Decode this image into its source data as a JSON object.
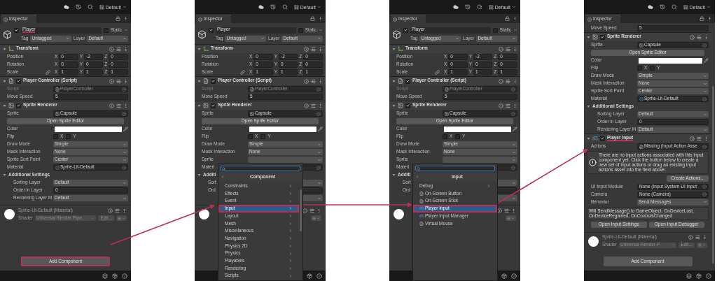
{
  "panels": [
    {
      "layout": "Default",
      "tab": "Inspector",
      "scrollable": false,
      "rows": [
        {
          "kind": "object",
          "name": "Player",
          "active": true,
          "underlined": true,
          "static_label": "Static",
          "static": false,
          "tag_label": "Tag",
          "tag": "Untagged",
          "layer_label": "Layer",
          "layer": "Default"
        },
        {
          "kind": "transform",
          "title": "Transform",
          "underlined": false
        },
        {
          "kind": "vector",
          "label": "Position",
          "linked": false,
          "fields": [
            {
              "axis": "X",
              "value": "0"
            },
            {
              "axis": "Y",
              "value": "-2"
            },
            {
              "axis": "Z",
              "value": "0"
            }
          ]
        },
        {
          "kind": "vector",
          "label": "Rotation",
          "linked": false,
          "fields": [
            {
              "axis": "X",
              "value": "0"
            },
            {
              "axis": "Y",
              "value": "0"
            },
            {
              "axis": "Z",
              "value": "0"
            }
          ]
        },
        {
          "kind": "vector",
          "label": "Scale",
          "linked": true,
          "fields": [
            {
              "axis": "X",
              "value": "1"
            },
            {
              "axis": "Y",
              "value": "1"
            },
            {
              "axis": "Z",
              "value": "1"
            }
          ]
        },
        {
          "kind": "script_component",
          "enabled": true,
          "underlined": false,
          "title": "Player Controller (Script)"
        },
        {
          "kind": "script_field",
          "label": "Script",
          "value": "PlayerController",
          "disabled": true
        },
        {
          "kind": "text_field",
          "label": "Move Speed",
          "value": "5",
          "disabled": false
        },
        {
          "kind": "sprite_component",
          "enabled": true,
          "underlined": false,
          "title": "Sprite Renderer"
        },
        {
          "kind": "sprite_field",
          "label": "Sprite",
          "value": "Capsule",
          "disabled": false
        },
        {
          "kind": "button",
          "label": "Open Sprite Editor"
        },
        {
          "kind": "color",
          "label": "Color",
          "color": "#ffffff"
        },
        {
          "kind": "flip",
          "label": "Flip",
          "options": [
            {
              "label": "X",
              "checked": false
            },
            {
              "label": "Y",
              "checked": false
            }
          ]
        },
        {
          "kind": "dropdown_field",
          "label": "Draw Mode",
          "value": "Simple",
          "disabled": false
        },
        {
          "kind": "dropdown_field",
          "label": "Mask Interaction",
          "value": "None",
          "disabled": false
        },
        {
          "kind": "dropdown_field",
          "label": "Sprite Sort Point",
          "value": "Center",
          "disabled": false
        },
        {
          "kind": "material_field",
          "label": "Material",
          "value": "Sprite-Lit-Default",
          "disabled": false
        },
        {
          "kind": "foldout",
          "label": "Additional Settings",
          "expanded": true,
          "children": [
            {
              "kind": "dropdown_field",
              "label": "Sorting Layer",
              "value": "Default",
              "disabled": false
            },
            {
              "kind": "text_field",
              "label": "Order in Layer",
              "value": "0",
              "disabled": false
            },
            {
              "kind": "dropdown_field",
              "label": "Rendering Layer M",
              "value": "Default",
              "disabled": false
            }
          ]
        },
        {
          "kind": "material",
          "name": "Sprite-Lit-Default (Material)",
          "shader_label": "Shader",
          "shader": "Universal Render Pipe",
          "edit": "Edit..."
        },
        {
          "kind": "add",
          "label": "Add Component",
          "highlighted": true
        }
      ]
    },
    {
      "layout": "Default",
      "tab": "Inspector",
      "scrollable": false,
      "rows": [
        {
          "kind": "object",
          "name": "Player",
          "active": true,
          "underlined": false,
          "static_label": "Static",
          "static": false,
          "tag_label": "Tag",
          "tag": "Untagged",
          "layer_label": "Layer",
          "layer": "Default"
        },
        {
          "kind": "transform",
          "title": "Transform",
          "underlined": false
        },
        {
          "kind": "vector",
          "label": "Position",
          "linked": false,
          "fields": [
            {
              "axis": "X",
              "value": "0"
            },
            {
              "axis": "Y",
              "value": "-2"
            },
            {
              "axis": "Z",
              "value": "0"
            }
          ]
        },
        {
          "kind": "vector",
          "label": "Rotation",
          "linked": false,
          "fields": [
            {
              "axis": "X",
              "value": "0"
            },
            {
              "axis": "Y",
              "value": "0"
            },
            {
              "axis": "Z",
              "value": "0"
            }
          ]
        },
        {
          "kind": "vector",
          "label": "Scale",
          "linked": true,
          "fields": [
            {
              "axis": "X",
              "value": "1"
            },
            {
              "axis": "Y",
              "value": "1"
            },
            {
              "axis": "Z",
              "value": "1"
            }
          ]
        },
        {
          "kind": "script_component",
          "enabled": true,
          "underlined": false,
          "title": "Player Controller (Script)"
        },
        {
          "kind": "script_field",
          "label": "Script",
          "value": "PlayerController",
          "disabled": true
        },
        {
          "kind": "text_field",
          "label": "Move Speed",
          "value": "5",
          "disabled": false
        },
        {
          "kind": "sprite_component",
          "enabled": true,
          "underlined": false,
          "title": "Sprite Renderer"
        },
        {
          "kind": "sprite_field",
          "label": "Sprite",
          "value": "Capsule",
          "disabled": false
        },
        {
          "kind": "button",
          "label": "Open Sprite Editor"
        },
        {
          "kind": "color",
          "label": "Color",
          "color": "#ffffff"
        },
        {
          "kind": "flip",
          "label": "Flip",
          "options": [
            {
              "label": "X",
              "checked": false
            },
            {
              "label": "Y",
              "checked": false
            }
          ]
        },
        {
          "kind": "dropdown_field",
          "label": "Draw Mode",
          "value": "Simple",
          "disabled": false
        },
        {
          "kind": "dropdown_field",
          "label": "Mask Interaction",
          "value": "None",
          "disabled": false
        },
        {
          "kind": "dropdown_field",
          "label": "Sprite",
          "disabled": false
        },
        {
          "kind": "object_field",
          "label": "Materi"
        },
        {
          "kind": "foldout",
          "label": "Additi",
          "expanded": true,
          "children": [
            {
              "kind": "dropdown_field",
              "label": "Sort"
            },
            {
              "kind": "text_field",
              "label": "Ord"
            },
            {
              "kind": "dropdown_field"
            }
          ]
        },
        {
          "kind": "material"
        }
      ],
      "popup": {
        "title": "Component",
        "scrollable": true,
        "items": [
          {
            "kind": "category",
            "label": "Constraints",
            "selected": false,
            "highlighted": false
          },
          {
            "kind": "category",
            "label": "Effects",
            "selected": false,
            "highlighted": false
          },
          {
            "kind": "category",
            "label": "Event",
            "selected": false,
            "highlighted": false
          },
          {
            "kind": "category",
            "label": "Input",
            "selected": true,
            "highlighted": true
          },
          {
            "kind": "category",
            "label": "Layout",
            "selected": false,
            "highlighted": false
          },
          {
            "kind": "category",
            "label": "Mesh",
            "selected": false,
            "highlighted": false
          },
          {
            "kind": "category",
            "label": "Miscellaneous",
            "selected": false,
            "highlighted": false
          },
          {
            "kind": "category",
            "label": "Navigation",
            "selected": false,
            "highlighted": false
          },
          {
            "kind": "category",
            "label": "Physics 2D",
            "selected": false,
            "highlighted": false
          },
          {
            "kind": "category",
            "label": "Physics",
            "selected": false,
            "highlighted": false
          },
          {
            "kind": "category",
            "label": "Playables",
            "selected": false,
            "highlighted": false
          },
          {
            "kind": "category",
            "label": "Rendering",
            "selected": false,
            "highlighted": false
          },
          {
            "kind": "category",
            "label": "Scripts",
            "selected": false,
            "highlighted": false
          }
        ]
      }
    },
    {
      "layout": "Default",
      "tab": "Inspector",
      "scrollable": false,
      "rows": [
        {
          "kind": "object",
          "name": "Player",
          "active": true,
          "underlined": false,
          "static_label": "Static",
          "static": false,
          "tag_label": "Tag",
          "tag": "Untagged",
          "layer_label": "Layer",
          "layer": "Default"
        },
        {
          "kind": "transform",
          "title": "Transform",
          "underlined": false
        },
        {
          "kind": "vector",
          "label": "Position",
          "linked": false,
          "fields": [
            {
              "axis": "X",
              "value": "0"
            },
            {
              "axis": "Y",
              "value": "-2"
            },
            {
              "axis": "Z",
              "value": "0"
            }
          ]
        },
        {
          "kind": "vector",
          "label": "Rotation",
          "linked": false,
          "fields": [
            {
              "axis": "X",
              "value": "0"
            },
            {
              "axis": "Y",
              "value": "0"
            },
            {
              "axis": "Z",
              "value": "0"
            }
          ]
        },
        {
          "kind": "vector",
          "label": "Scale",
          "linked": true,
          "fields": [
            {
              "axis": "X",
              "value": "1"
            },
            {
              "axis": "Y",
              "value": "1"
            },
            {
              "axis": "Z",
              "value": "1"
            }
          ]
        },
        {
          "kind": "script_component",
          "enabled": true,
          "underlined": false,
          "title": "Player Controller (Script)"
        },
        {
          "kind": "script_field",
          "label": "Script",
          "value": "PlayerController",
          "disabled": true
        },
        {
          "kind": "text_field",
          "label": "Move Speed",
          "value": "5",
          "disabled": false
        },
        {
          "kind": "sprite_component",
          "enabled": true,
          "underlined": false,
          "title": "Sprite Renderer"
        },
        {
          "kind": "sprite_field",
          "label": "Sprite",
          "value": "Capsule",
          "disabled": false
        },
        {
          "kind": "button",
          "label": "Open Sprite Editor"
        },
        {
          "kind": "color",
          "label": "Color",
          "color": "#ffffff"
        },
        {
          "kind": "flip",
          "label": "Flip",
          "options": [
            {
              "label": "X",
              "checked": false
            },
            {
              "label": "Y",
              "checked": false
            }
          ]
        },
        {
          "kind": "dropdown_field",
          "label": "Draw Mode",
          "value": "Simple",
          "disabled": false
        },
        {
          "kind": "dropdown_field",
          "label": "Mask Interaction",
          "value": "None",
          "disabled": false
        },
        {
          "kind": "dropdown_field",
          "label": "Sprite",
          "disabled": false
        },
        {
          "kind": "object_field",
          "label": "Materi"
        },
        {
          "kind": "foldout",
          "label": "Additi",
          "expanded": true,
          "children": [
            {
              "kind": "dropdown_field",
              "label": "Sort"
            },
            {
              "kind": "text_field",
              "label": "Ord"
            },
            {
              "kind": "dropdown_field"
            }
          ]
        },
        {
          "kind": "material"
        }
      ],
      "popup": {
        "title": "Input",
        "scrollable": false,
        "items": [
          {
            "kind": "category",
            "label": "Debug",
            "selected": false,
            "highlighted": false
          },
          {
            "kind": "script",
            "label": "On-Screen Button",
            "selected": false,
            "highlighted": false
          },
          {
            "kind": "script",
            "label": "On-Screen Stick",
            "selected": false,
            "highlighted": false
          },
          {
            "kind": "input",
            "label": "Player Input",
            "selected": true,
            "highlighted": true
          },
          {
            "kind": "input",
            "label": "Player Input Manager",
            "selected": false,
            "highlighted": false
          },
          {
            "kind": "script",
            "label": "Virtual Mouse",
            "selected": false,
            "highlighted": false
          }
        ]
      }
    },
    {
      "layout": "Default",
      "tab": "Inspector",
      "scrollable": true,
      "rows": [
        {
          "kind": "text_field",
          "label": "Move Speed",
          "value": "5",
          "disabled": false
        },
        {
          "kind": "sprite_component",
          "enabled": true,
          "underlined": false,
          "title": "Sprite Renderer"
        },
        {
          "kind": "sprite_field",
          "label": "Sprite",
          "value": "Capsule",
          "disabled": false
        },
        {
          "kind": "button",
          "label": "Open Sprite Editor"
        },
        {
          "kind": "color",
          "label": "Color",
          "color": "#ffffff"
        },
        {
          "kind": "flip",
          "label": "Flip",
          "options": [
            {
              "label": "X",
              "checked": false
            },
            {
              "label": "Y",
              "checked": false
            }
          ]
        },
        {
          "kind": "dropdown_field",
          "label": "Draw Mode",
          "value": "Simple",
          "disabled": false
        },
        {
          "kind": "dropdown_field",
          "label": "Mask Interaction",
          "value": "None",
          "disabled": false
        },
        {
          "kind": "dropdown_field",
          "label": "Sprite Sort Point",
          "value": "Center",
          "disabled": false
        },
        {
          "kind": "material_field",
          "label": "Material",
          "value": "Sprite-Lit-Default",
          "disabled": false
        },
        {
          "kind": "foldout",
          "label": "Additional Settings",
          "expanded": true,
          "children": [
            {
              "kind": "dropdown_field",
              "label": "Sorting Layer",
              "value": "Default",
              "disabled": false
            },
            {
              "kind": "text_field",
              "label": "Order in Layer",
              "value": "0",
              "disabled": false
            },
            {
              "kind": "dropdown_field",
              "label": "Rendering Layer M",
              "value": "Default",
              "disabled": false
            }
          ]
        },
        {
          "kind": "input_component",
          "enabled": true,
          "underlined": true,
          "title": "Player Input"
        },
        {
          "kind": "asset_field",
          "label": "Actions",
          "value": "Missing (Input Action Asse",
          "disabled": false
        },
        {
          "kind": "help",
          "text": "There are no input actions associated with this input component yet. Click the button below to create a new set of input actions or drag an existing input actions asset into the field above."
        },
        {
          "kind": "action",
          "label": "Create Actions..."
        },
        {
          "kind": "object_field",
          "label": "UI Input Module",
          "value": "None (Input System UI Input",
          "disabled": false
        },
        {
          "kind": "object_field",
          "label": "Camera",
          "value": "None (Camera)",
          "disabled": false
        },
        {
          "kind": "dropdown_field",
          "label": "Behavior",
          "value": "Send Messages",
          "disabled": false
        },
        {
          "kind": "note",
          "text": "Will SendMessage() to GameObject: OnDeviceLost, OnDeviceRegained, OnControlsChanged"
        },
        {
          "kind": "buttons",
          "labels": [
            "Open Input Settings",
            "Open Input Debugger"
          ]
        },
        {
          "kind": "material",
          "name": "Sprite-Lit-Default (Material)",
          "shader_label": "Shader",
          "shader": "Universal Render P",
          "edit": "Edit..."
        },
        {
          "kind": "add",
          "label": "Add Component",
          "highlighted": false
        }
      ]
    }
  ]
}
